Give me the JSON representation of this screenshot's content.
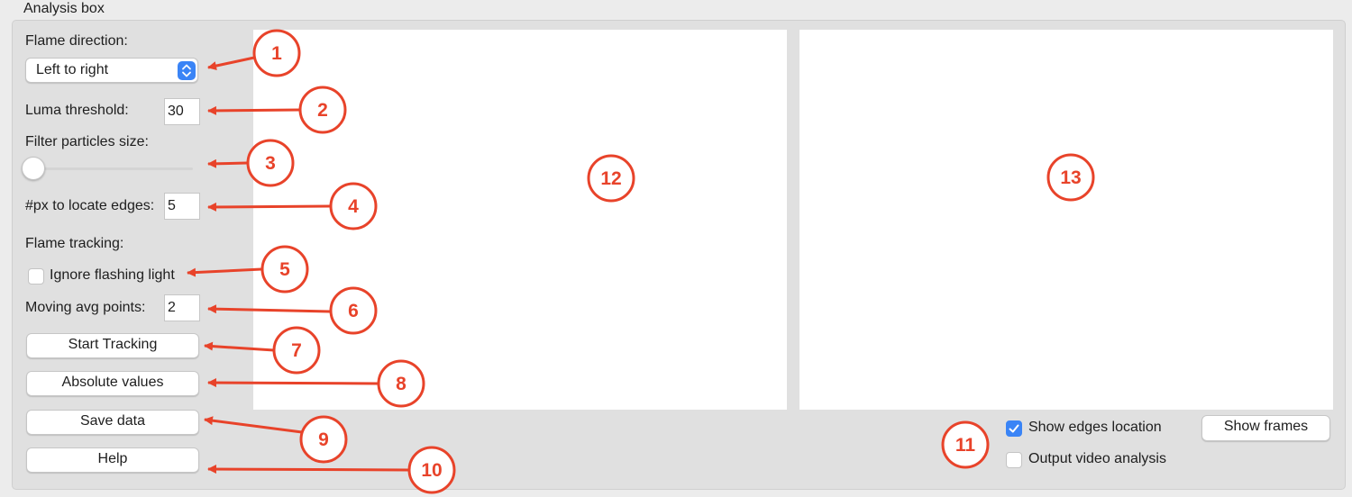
{
  "group_title": "Analysis box",
  "flame_direction": {
    "label": "Flame direction:",
    "value": "Left to right"
  },
  "luma_threshold": {
    "label": "Luma threshold:",
    "value": "30"
  },
  "filter_particles": {
    "label": "Filter particles size:",
    "value": 0
  },
  "px_edges": {
    "label": "#px to locate edges:",
    "value": "5"
  },
  "flame_tracking": {
    "label": "Flame tracking:"
  },
  "ignore_flashing": {
    "label": "Ignore flashing light",
    "checked": false
  },
  "moving_avg": {
    "label": "Moving avg points:",
    "value": "2"
  },
  "buttons": {
    "start_tracking": "Start Tracking",
    "absolute_values": "Absolute values",
    "save_data": "Save data",
    "help": "Help",
    "show_frames": "Show frames"
  },
  "show_edges": {
    "label": "Show edges location",
    "checked": true
  },
  "output_video": {
    "label": "Output video analysis",
    "checked": false
  },
  "annotations": [
    "1",
    "2",
    "3",
    "4",
    "5",
    "6",
    "7",
    "8",
    "9",
    "10",
    "11",
    "12",
    "13"
  ],
  "colors": {
    "annotation": "#e8432a",
    "accent": "#3a84f6"
  }
}
